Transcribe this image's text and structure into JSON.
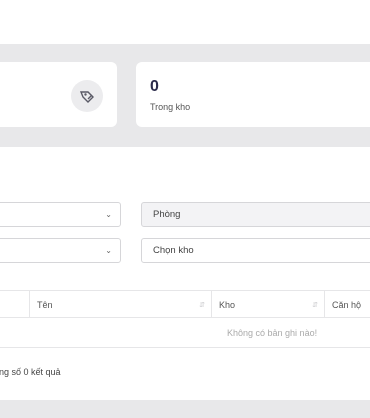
{
  "stats": {
    "left_icon": "tag-edit-icon",
    "right": {
      "value": "0",
      "label": "Trong kho"
    }
  },
  "filters": {
    "room_placeholder": "Phòng",
    "warehouse_placeholder": "Chọn kho"
  },
  "table": {
    "headers": [
      "",
      "Tên",
      "Kho",
      "Căn hộ"
    ],
    "empty_message": "Không có bản ghi nào!"
  },
  "footer": {
    "total_text": "ổng số 0 kết quả"
  }
}
